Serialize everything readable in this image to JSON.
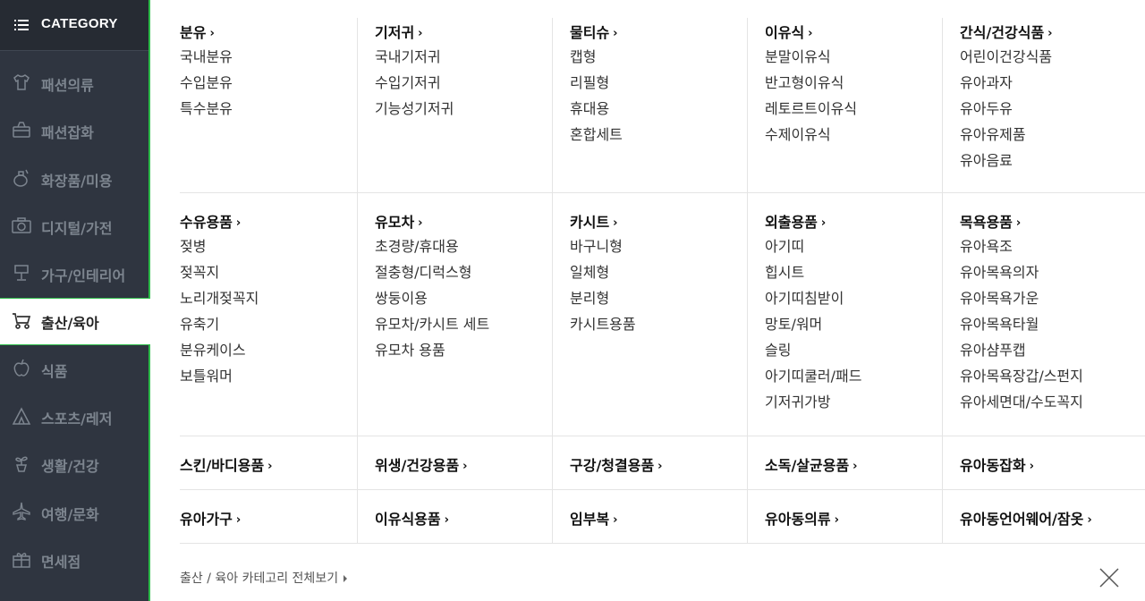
{
  "sidebar": {
    "header": "CATEGORY",
    "items": [
      {
        "label": "패션의류",
        "icon": "shirt-icon"
      },
      {
        "label": "패션잡화",
        "icon": "bag-icon"
      },
      {
        "label": "화장품/미용",
        "icon": "cosmetics-icon"
      },
      {
        "label": "디지털/가전",
        "icon": "camera-icon"
      },
      {
        "label": "가구/인테리어",
        "icon": "lamp-icon"
      },
      {
        "label": "출산/육아",
        "icon": "stroller-icon",
        "active": true
      },
      {
        "label": "식품",
        "icon": "apple-icon"
      },
      {
        "label": "스포츠/레저",
        "icon": "tent-icon"
      },
      {
        "label": "생활/건강",
        "icon": "plant-icon"
      },
      {
        "label": "여행/문화",
        "icon": "airplane-icon"
      },
      {
        "label": "면세점",
        "icon": "gift-icon"
      }
    ],
    "accent_color": "#2ebd4a"
  },
  "panel": {
    "row1": [
      {
        "title": "분유",
        "items": [
          "국내분유",
          "수입분유",
          "특수분유"
        ]
      },
      {
        "title": "기저귀",
        "items": [
          "국내기저귀",
          "수입기저귀",
          "기능성기저귀"
        ]
      },
      {
        "title": "물티슈",
        "items": [
          "캡형",
          "리필형",
          "휴대용",
          "혼합세트"
        ]
      },
      {
        "title": "이유식",
        "items": [
          "분말이유식",
          "반고형이유식",
          "레토르트이유식",
          "수제이유식"
        ]
      },
      {
        "title": "간식/건강식품",
        "items": [
          "어린이건강식품",
          "유아과자",
          "유아두유",
          "유아유제품",
          "유아음료"
        ]
      }
    ],
    "row2": [
      {
        "title": "수유용품",
        "items": [
          "젖병",
          "젖꼭지",
          "노리개젖꼭지",
          "유축기",
          "분유케이스",
          "보틀워머"
        ]
      },
      {
        "title": "유모차",
        "items": [
          "초경량/휴대용",
          "절충형/디럭스형",
          "쌍둥이용",
          "유모차/카시트 세트",
          "유모차 용품"
        ]
      },
      {
        "title": "카시트",
        "items": [
          "바구니형",
          "일체형",
          "분리형",
          "카시트용품"
        ]
      },
      {
        "title": "외출용품",
        "items": [
          "아기띠",
          "힙시트",
          "아기띠침받이",
          "망토/워머",
          "슬링",
          "아기띠쿨러/패드",
          "기저귀가방"
        ]
      },
      {
        "title": "목욕용품",
        "items": [
          "유아욕조",
          "유아목욕의자",
          "유아목욕가운",
          "유아목욕타월",
          "유아샴푸캡",
          "유아목욕장갑/스펀지",
          "유아세면대/수도꼭지"
        ]
      }
    ],
    "row3": [
      "스킨/바디용품",
      "위생/건강용품",
      "구강/청결용품",
      "소독/살균용품",
      "유아동잡화"
    ],
    "row4": [
      "유아가구",
      "이유식용품",
      "임부복",
      "유아동의류",
      "유아동언어웨어/잠옷"
    ],
    "chevron": "›",
    "footer_link": "출산 / 육아 카테고리 전체보기"
  }
}
